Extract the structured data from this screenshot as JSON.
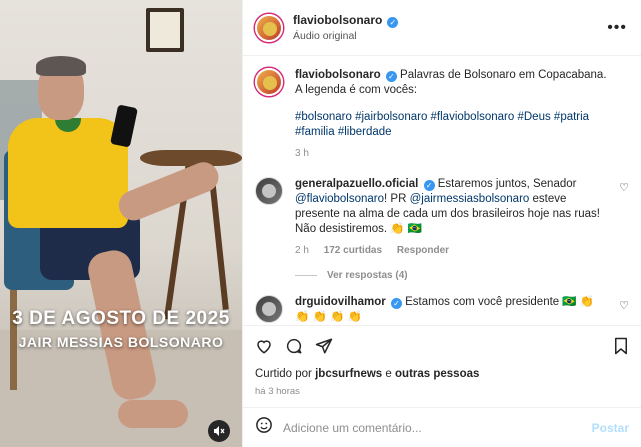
{
  "media": {
    "overlay_date": "3 DE AGOSTO DE 2025",
    "overlay_name": "JAIR MESSIAS BOLSONARO",
    "mute_icon": "speaker-muted-icon"
  },
  "header": {
    "username": "flaviobolsonaro",
    "subtitle": "Áudio original",
    "more_icon": "more-horizontal-icon"
  },
  "caption": {
    "username": "flaviobolsonaro",
    "text": "Palavras de Bolsonaro em Copacabana. A legenda é com vocês:",
    "hashtags": "#bolsonaro #jairbolsonaro #flaviobolsonaro #Deus #patria #familia #liberdade",
    "time": "3 h"
  },
  "comments": [
    {
      "username": "generalpazuello.oficial",
      "text_1": "Estaremos juntos, Senador",
      "mention_1": "@flaviobolsonaro",
      "text_2": "! PR",
      "mention_2": "@jairmessiasbolsonaro",
      "text_3": "esteve presente na alma de cada um dos brasileiros hoje nas ruas! Não desistiremos. 👏 🇧🇷",
      "time": "2 h",
      "likes": "172 curtidas",
      "reply": "Responder",
      "view_replies": "Ver respostas (4)"
    },
    {
      "username": "drguidovilhamor",
      "text": "Estamos com você presidente 🇧🇷 👏 👏 👏 👏 👏"
    }
  ],
  "actions": {
    "liked_prefix": "Curtido por",
    "liked_user": "jbcsurfnews",
    "liked_mid": "e",
    "liked_rest": "outras pessoas",
    "time": "há 3 horas"
  },
  "add_comment": {
    "placeholder": "Adicione um comentário...",
    "post_label": "Postar"
  },
  "colors": {
    "link": "#00376b",
    "verified": "#3897f0",
    "post_disabled": "#b2dffc"
  }
}
